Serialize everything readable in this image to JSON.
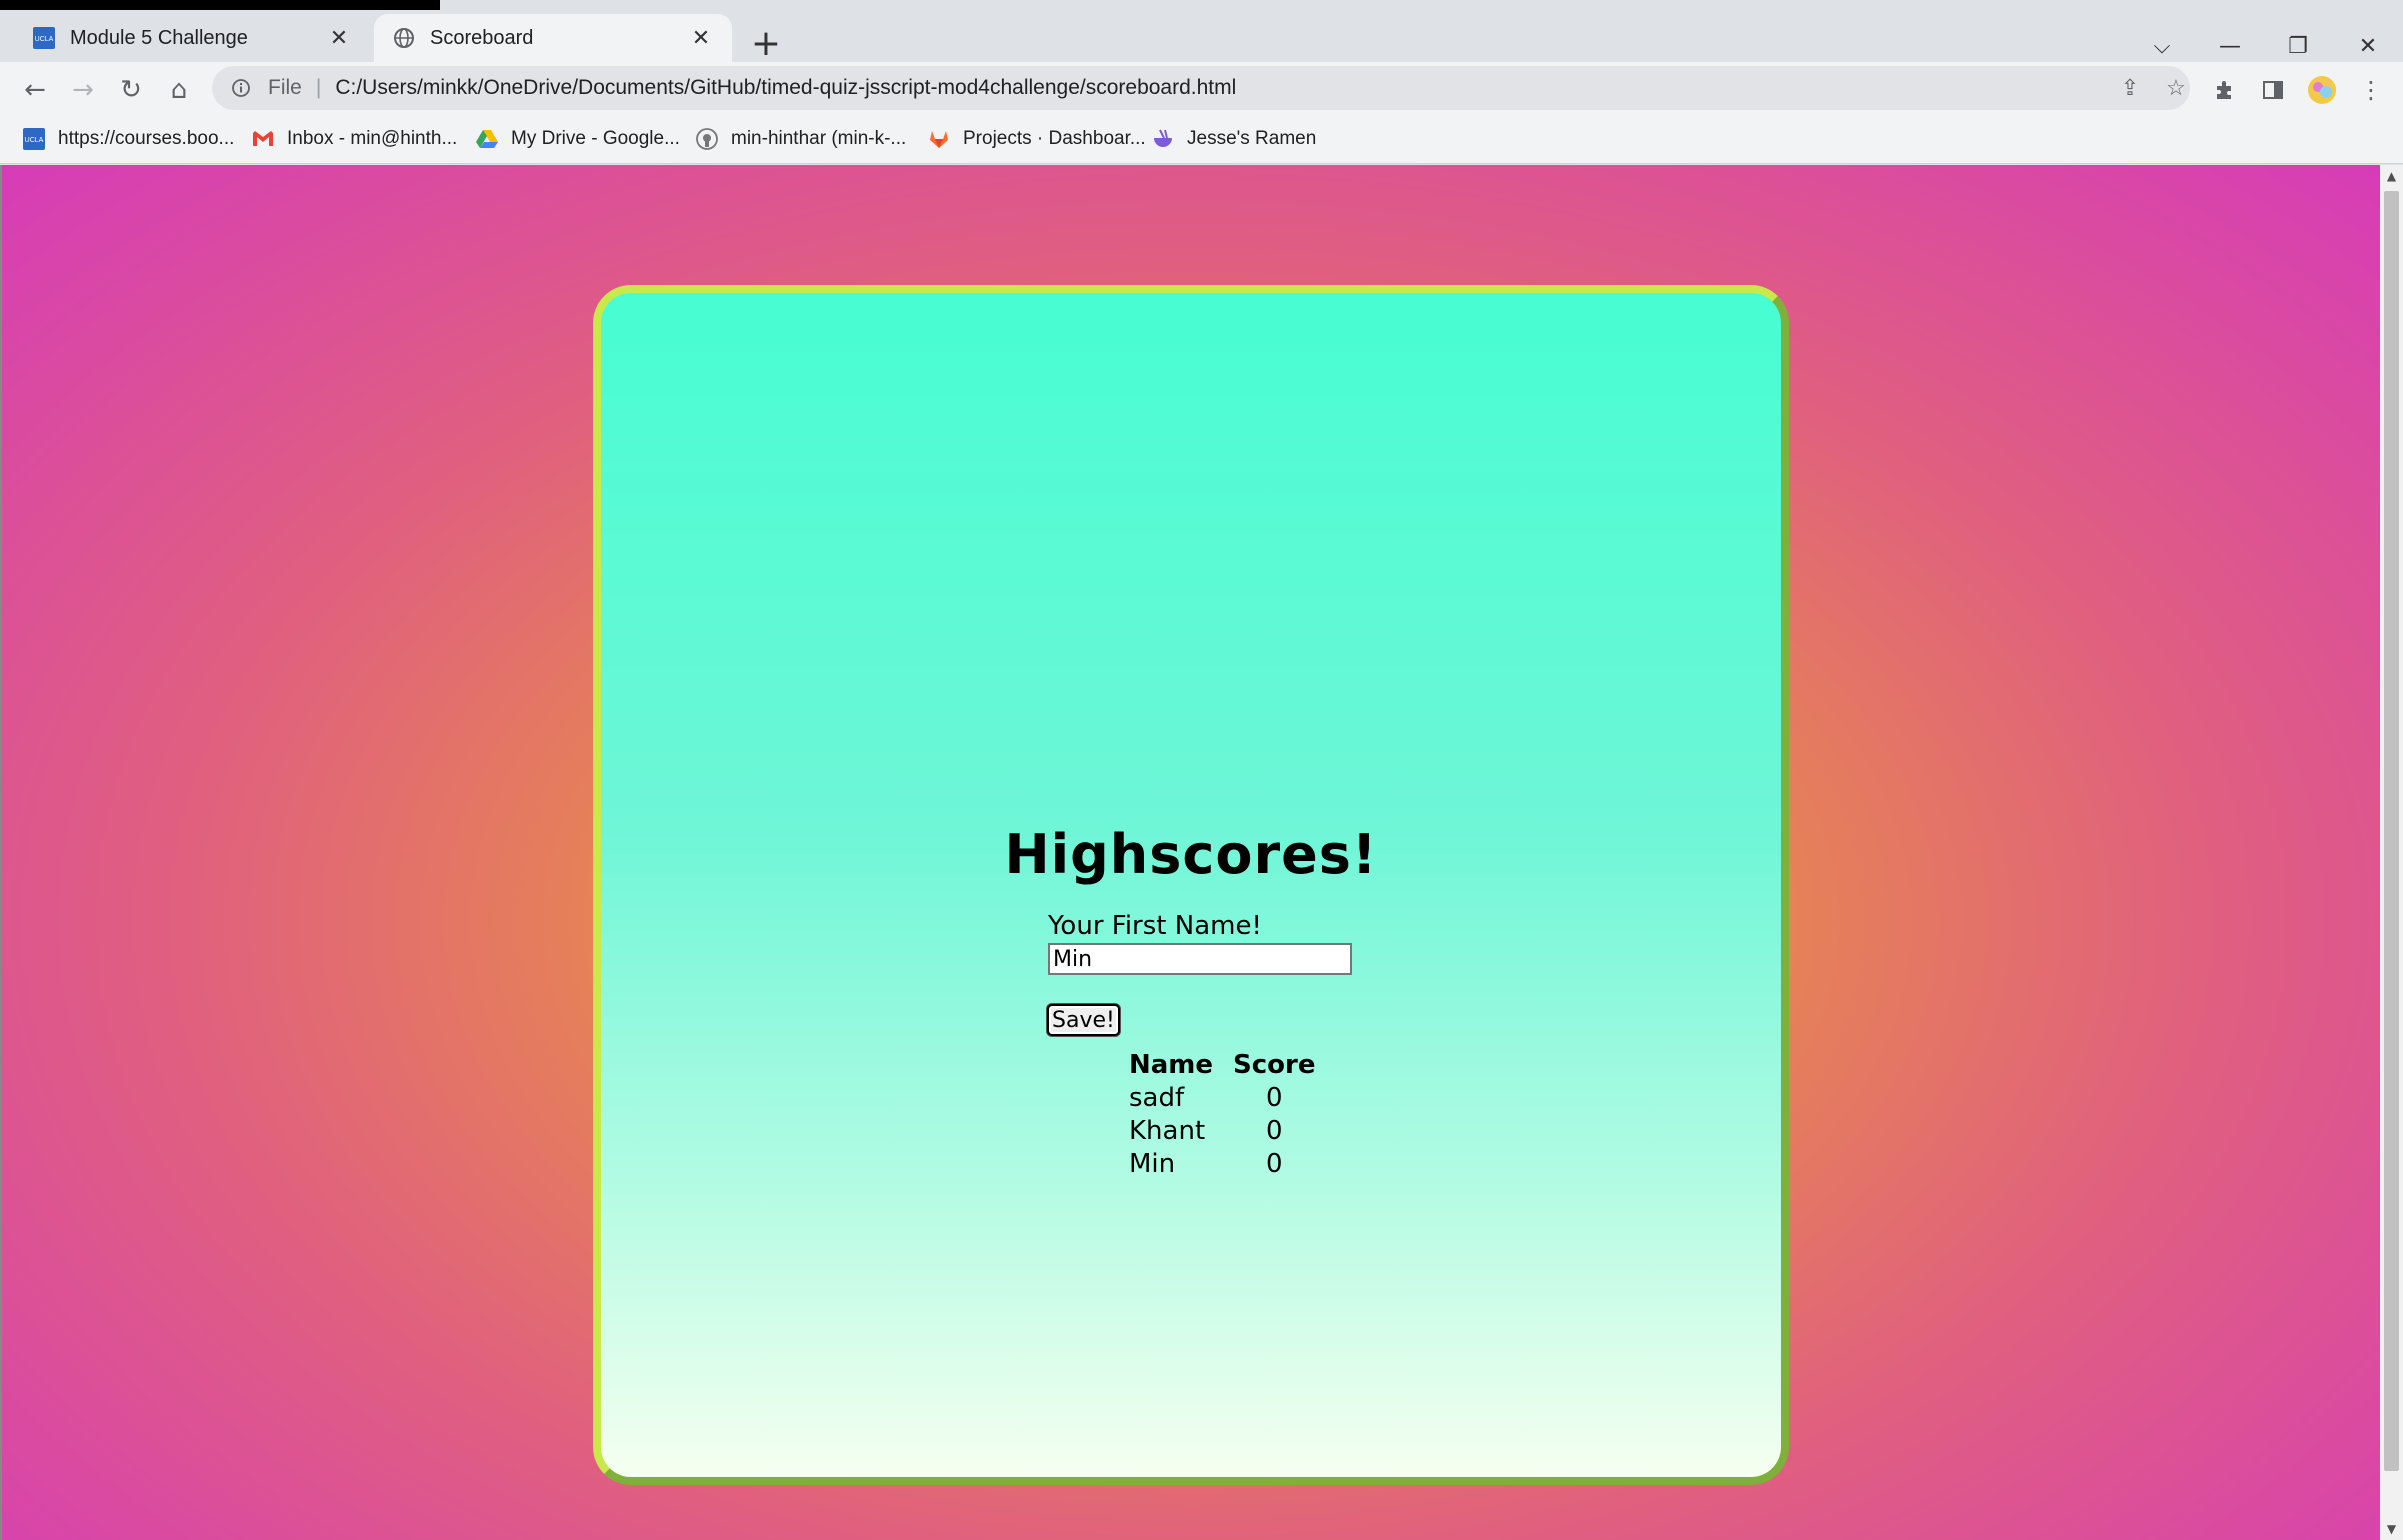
{
  "browser": {
    "tabs": [
      {
        "label": "Module 5 Challenge",
        "icon": "ucla-icon",
        "active": false
      },
      {
        "label": "Scoreboard",
        "icon": "globe-icon",
        "active": true
      }
    ],
    "new_tab_symbol": "+",
    "address": {
      "scheme_label": "File",
      "url": "C:/Users/minkk/OneDrive/Documents/GitHub/timed-quiz-jsscript-mod4challenge/scoreboard.html"
    },
    "bookmarks": [
      {
        "label": "https://courses.boo...",
        "icon": "ucla-icon"
      },
      {
        "label": "Inbox - min@hinth...",
        "icon": "gmail-icon"
      },
      {
        "label": "My Drive - Google...",
        "icon": "google-drive-icon"
      },
      {
        "label": "min-hinthar (min-k-...",
        "icon": "github-icon"
      },
      {
        "label": "Projects · Dashboar...",
        "icon": "gitlab-icon"
      },
      {
        "label": "Jesse's Ramen",
        "icon": "ramen-icon"
      }
    ]
  },
  "page": {
    "heading": "Highscores!",
    "name_label": "Your First Name!",
    "name_value": "Min",
    "save_label": "Save!",
    "table": {
      "headers": [
        "Name",
        "Score"
      ],
      "rows": [
        {
          "name": "sadf",
          "score": "0"
        },
        {
          "name": "Khant",
          "score": "0"
        },
        {
          "name": "Min",
          "score": "0"
        }
      ]
    }
  },
  "colors": {
    "card_top": "#47fdd2",
    "card_bottom": "#f6fff0",
    "card_border": "#c9e84a",
    "background_center": "#f0a040",
    "background_edge": "#d63cb8"
  }
}
